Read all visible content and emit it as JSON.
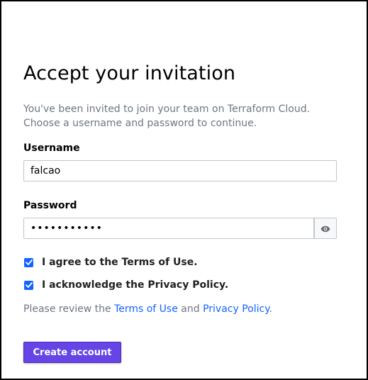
{
  "page": {
    "title": "Accept your invitation",
    "intro": "You've been invited to join your team on Terraform Cloud. Choose a username and password to continue."
  },
  "form": {
    "username": {
      "label": "Username",
      "value": "falcao"
    },
    "password": {
      "label": "Password",
      "value": "•••••••••••",
      "toggle_icon": "eye-icon"
    },
    "terms_checkbox": {
      "label": "I agree to the Terms of Use.",
      "checked": true
    },
    "privacy_checkbox": {
      "label": "I acknowledge the Privacy Policy.",
      "checked": true
    },
    "review": {
      "prefix": "Please review the ",
      "terms_link": "Terms of Use",
      "middle": " and ",
      "privacy_link": "Privacy Policy",
      "suffix": "."
    },
    "submit_label": "Create account"
  },
  "colors": {
    "accent": "#1563ff",
    "primary_button": "#6545e6",
    "muted_text": "#6f7682"
  }
}
